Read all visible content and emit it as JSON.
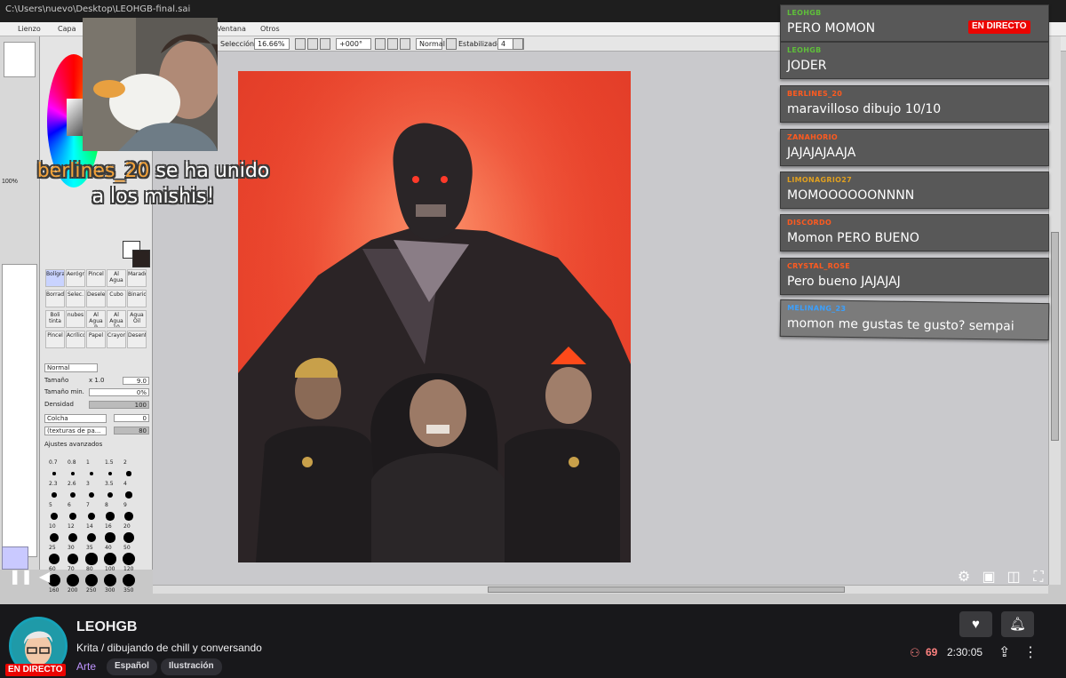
{
  "app": {
    "title_path": "C:\\Users\\nuevo\\Desktop\\LEOHGB-final.sai",
    "menus": [
      "Lienzo",
      "Capa",
      "Ventana",
      "Otros"
    ],
    "toolbar": {
      "selection_label": "Selección",
      "zoom": "16.66%",
      "rotation": "+000°",
      "blend_mode": "Normal",
      "stabilizer_label": "Estabilizador",
      "stabilizer_value": "4"
    },
    "left_opacity": "100%",
    "tools": [
      "Bolígrafo",
      "Aerógraf",
      "Pincel",
      "Al Agua",
      "Marador",
      "Borrador",
      "Selec.",
      "Deselec.",
      "Cubo",
      "Binario",
      "Boli tinta",
      "nubes",
      "Al Agua 9",
      "Al Agua 10",
      "Agua Oil",
      "Pincel",
      "Acrílico",
      "Papel",
      "Crayon",
      "Desenf."
    ],
    "brush_props": {
      "blend": "Normal",
      "size_label": "Tamaño",
      "size_multiplier": "x 1.0",
      "size_value": "9.0",
      "min_size_label": "Tamaño min.",
      "min_size_value": "0%",
      "density_label": "Densidad",
      "density_value": "100",
      "texture_a": "Colcha",
      "texture_a_value": "0",
      "texture_b": "(texturas de pa...",
      "texture_b_value": "80",
      "advanced_label": "Ajustes avanzados"
    },
    "brush_sizes": [
      "0.7",
      "0.8",
      "1",
      "1.5",
      "2",
      "2.3",
      "2.6",
      "3",
      "3.5",
      "4",
      "5",
      "6",
      "7",
      "8",
      "9",
      "10",
      "12",
      "14",
      "16",
      "20",
      "25",
      "30",
      "35",
      "40",
      "50",
      "60",
      "70",
      "80",
      "100",
      "120",
      "160",
      "200",
      "250",
      "300",
      "350"
    ]
  },
  "overlay": {
    "follower_name": "berlines_20",
    "follower_text_1": "se ha unido",
    "follower_text_2": "a los mishis!",
    "live_label": "EN DIRECTO"
  },
  "chat": [
    {
      "user": "LEOHGB",
      "user_color": "#5fbf3a",
      "text": "PERO MOMON"
    },
    {
      "user": "LEOHGB",
      "user_color": "#5fbf3a",
      "text": "JODER"
    },
    {
      "user": "BERLINES_20",
      "user_color": "#ff5a1f",
      "text": "maravilloso dibujo 10/10"
    },
    {
      "user": "ZANAHORIO",
      "user_color": "#ff5a1f",
      "text": "JAJAJAJAAJA"
    },
    {
      "user": "LIMONAGRIO27",
      "user_color": "#e0a020",
      "text": "MOMOOOOOONNNN"
    },
    {
      "user": "DISCORDO",
      "user_color": "#ff5a1f",
      "text": "Momon PERO BUENO"
    },
    {
      "user": "CRYSTAL_ROSE",
      "user_color": "#ff5a1f",
      "text": "Pero bueno JAJAJAJ"
    },
    {
      "user": "MELINANG_23",
      "user_color": "#3aa0ff",
      "text": "momon me gustas te gusto? sempai"
    }
  ],
  "channel": {
    "name": "LEOHGB",
    "title": "Krita / dibujando de chill y conversando",
    "category": "Arte",
    "tags": [
      "Español",
      "Ilustración"
    ],
    "live_badge": "EN DIRECTO",
    "viewers": "69",
    "uptime": "2:30:05"
  },
  "icons": {
    "pause": "pause-icon",
    "volume": "volume-icon",
    "settings": "gear-icon",
    "clip": "clip-icon",
    "theatre": "theatre-mode-icon",
    "fullscreen": "fullscreen-icon",
    "follow": "heart-icon",
    "notify": "bell-icon",
    "share": "share-icon",
    "more": "more-vertical-icon",
    "viewers": "person-icon"
  }
}
